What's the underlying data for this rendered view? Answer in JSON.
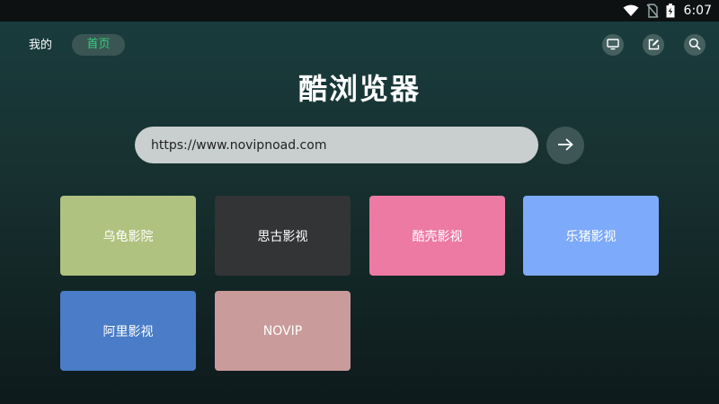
{
  "status_bar": {
    "time": "6:07",
    "icons": [
      "wifi-icon",
      "no-sim-icon",
      "battery-charging-icon"
    ]
  },
  "header": {
    "tabs": [
      {
        "label": "我的",
        "active": false
      },
      {
        "label": "首页",
        "active": true
      }
    ],
    "actions": [
      "tv-icon",
      "edit-icon",
      "search-icon"
    ],
    "active_color": "#2fd17b"
  },
  "title": "酷浏览器",
  "url_bar": {
    "value": "https://www.novipnoad.com",
    "go_icon": "arrow-right-icon"
  },
  "sites": [
    {
      "label": "乌龟影院",
      "color": "#b0c27f"
    },
    {
      "label": "思古影视",
      "color": "#333436"
    },
    {
      "label": "酷壳影视",
      "color": "#ec7aa3"
    },
    {
      "label": "乐猪影视",
      "color": "#7daafa"
    },
    {
      "label": "阿里影视",
      "color": "#4a7cc7"
    },
    {
      "label": "NOVIP",
      "color": "#c99b9b"
    }
  ]
}
